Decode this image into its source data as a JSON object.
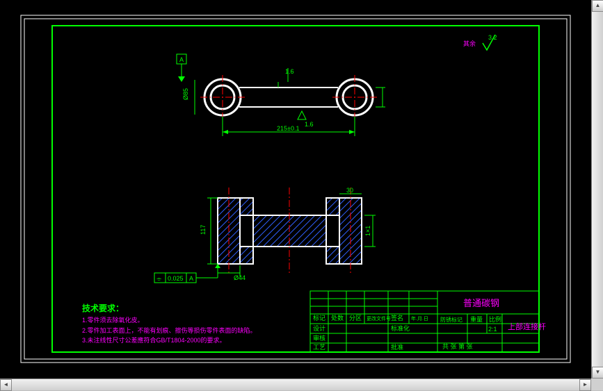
{
  "surfaceFinish": {
    "label": "其余",
    "value": "3.2"
  },
  "gdt": {
    "flatness": "⎕",
    "dim1": "1.6",
    "dim2": "215±0.1",
    "surf": "1.6",
    "sideDim": "Ø85"
  },
  "section": {
    "h": "117",
    "w": "Ø44",
    "smallDim": "1×1",
    "side": "30"
  },
  "tol": {
    "sym": "⌯",
    "val": "0.025",
    "datum": "A"
  },
  "tech": {
    "title": "技术要求：",
    "l1": "1.零件须去除氧化皮。",
    "l2": "2.零件加工表面上，不能有划痕、擦伤等损伤零件表面的缺陷。",
    "l3": "3.未注线性尺寸公差應符合GB/T1804-2000的要求。"
  },
  "titleBlock": {
    "material": "普通碳钢",
    "partName": "上部连接杆",
    "r1c1": "标记",
    "r1c2": "处数",
    "r1c3": "分区",
    "r1c4": "更改文件号",
    "r1c5": "签名",
    "r1c6": "年.月.日",
    "r2c1": "设计",
    "r2c2": "",
    "r2c3": "标准化",
    "r2c4": "",
    "r3c1": "审核",
    "r4c1": "工艺",
    "r4c2": "批准",
    "sideCol1": "防锈标记",
    "sideCol2": "重量",
    "sideCol3": "比例",
    "scale": "2:1",
    "bottom": "共   张   第   张"
  }
}
